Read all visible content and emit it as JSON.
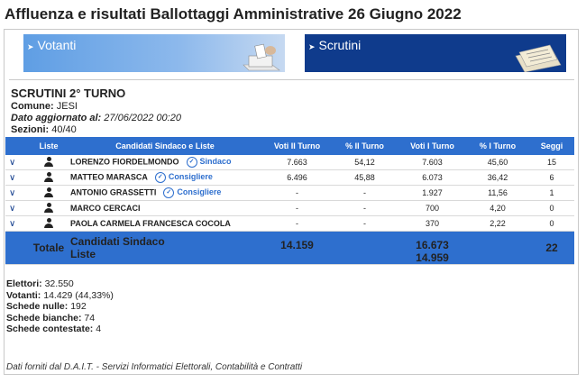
{
  "page_title": "Affluenza e risultati Ballottaggi Amministrative 26 Giugno 2022",
  "nav": {
    "votanti": "Votanti",
    "scrutini": "Scrutini"
  },
  "info": {
    "heading": "SCRUTINI 2° TURNO",
    "comune_label": "Comune:",
    "comune_value": "JESI",
    "data_label": "Dato aggiornato al:",
    "data_value": "27/06/2022 00:20",
    "sezioni_label": "Sezioni:",
    "sezioni_value": "40/40"
  },
  "table": {
    "headers": {
      "liste": "Liste",
      "candidati": "Candidati Sindaco e Liste",
      "voti2": "Voti II Turno",
      "perc2": "% II Turno",
      "voti1": "Voti I Turno",
      "perc1": "% I Turno",
      "seggi": "Seggi"
    },
    "rows": [
      {
        "name": "LORENZO FIORDELMONDO",
        "role": "Sindaco",
        "voti2": "7.663",
        "perc2": "54,12",
        "voti1": "7.603",
        "perc1": "45,60",
        "seggi": "15"
      },
      {
        "name": "MATTEO MARASCA",
        "role": "Consigliere",
        "voti2": "6.496",
        "perc2": "45,88",
        "voti1": "6.073",
        "perc1": "36,42",
        "seggi": "6"
      },
      {
        "name": "ANTONIO GRASSETTI",
        "role": "Consigliere",
        "voti2": "-",
        "perc2": "-",
        "voti1": "1.927",
        "perc1": "11,56",
        "seggi": "1"
      },
      {
        "name": "MARCO CERCACI",
        "role": "",
        "voti2": "-",
        "perc2": "-",
        "voti1": "700",
        "perc1": "4,20",
        "seggi": "0"
      },
      {
        "name": "PAOLA CARMELA FRANCESCA COCOLA",
        "role": "",
        "voti2": "-",
        "perc2": "-",
        "voti1": "370",
        "perc1": "2,22",
        "seggi": "0"
      }
    ],
    "total": {
      "label": "Totale",
      "cand_line1": "Candidati Sindaco",
      "cand_line2": "Liste",
      "voti2": "14.159",
      "voti1_line1": "16.673",
      "voti1_line2": "14.959",
      "seggi": "22"
    }
  },
  "stats": {
    "elettori_label": "Elettori:",
    "elettori_value": "32.550",
    "votanti_label": "Votanti:",
    "votanti_value": "14.429 (44,33%)",
    "nulle_label": "Schede nulle:",
    "nulle_value": "192",
    "bianche_label": "Schede bianche:",
    "bianche_value": "74",
    "contestate_label": "Schede contestate:",
    "contestate_value": "4"
  },
  "footer": "Dati forniti dal D.A.I.T. - Servizi Informatici Elettorali, Contabilità e Contratti",
  "colors": {
    "primary_blue": "#2e6fce",
    "dark_blue": "#0f3b8c",
    "light_blue": "#8db9ec"
  }
}
